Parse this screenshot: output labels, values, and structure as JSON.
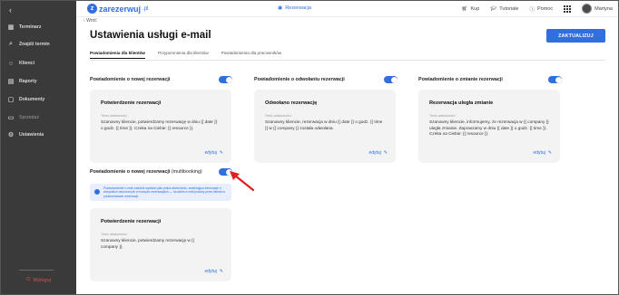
{
  "sidebar": {
    "items": [
      {
        "label": "Terminarz",
        "icon": "calendar-icon"
      },
      {
        "label": "Znajdź termin",
        "icon": "search-icon"
      },
      {
        "label": "Klienci",
        "icon": "users-icon"
      },
      {
        "label": "Raporty",
        "icon": "chart-icon"
      },
      {
        "label": "Dokumenty",
        "icon": "document-icon"
      },
      {
        "label": "Sprzedaż",
        "icon": "cart-icon"
      },
      {
        "label": "Ustawienia",
        "icon": "gear-icon"
      }
    ],
    "logout_label": "Wyloguj"
  },
  "topbar": {
    "logo_text": "zarezerwuj",
    "logo_tld": ".pl",
    "center_label": "Rezerwacja",
    "shop_label": "Kup",
    "tutorials_label": "Tutoriale",
    "help_label": "Pomoc",
    "user_name": "Martyna"
  },
  "main": {
    "back_label": "Wróć",
    "title": "Ustawienia usługi e-mail",
    "update_button": "ZAKTUALIZUJ",
    "tabs": [
      {
        "label": "Powiadomienia dla klientów",
        "active": true
      },
      {
        "label": "Przypomnienia dla klientów",
        "active": false
      },
      {
        "label": "Powiadomienia dla pracowników",
        "active": false
      }
    ],
    "sections": [
      {
        "title": "Powiadomienie o nowej rezerwacji",
        "enabled": true,
        "card": {
          "title": "Potwierdzenie rezerwacji",
          "label": "Treść wiadomości",
          "text": "Szanowny kliencie, potwierdzamy rezerwację w dniu {{ date }} o godz. {{ time }}. Czeka na Ciebie: {{ resource }}.",
          "edit": "edytuj"
        }
      },
      {
        "title": "Powiadomienie o odwołaniu rezerwacji",
        "enabled": true,
        "card": {
          "title": "Odwołano rezerwację",
          "label": "Treść wiadomości",
          "text": "Szanowny kliencie, rezerwacja w dniu {{ date }} o godz. {{ time }} w {{ company }} została odwołana.",
          "edit": "edytuj"
        }
      },
      {
        "title": "Powiadomienie o zmianie rezerwacji",
        "enabled": true,
        "card": {
          "title": "Rezerwacja uległa zmianie",
          "label": "Treść wiadomości",
          "text": "Szanowny kliencie, informujemy, że rezerwacja w {{ company }} uległa zmianie. Zapraszamy w dniu {{ date }} o godz. {{ time }}. Czeka na Ciebie: {{ resource }}.",
          "edit": "edytuj"
        }
      }
    ],
    "multibooking": {
      "title_main": "Powiadomienie o nowej rezerwacji",
      "title_suffix": "(multibooking)",
      "enabled": true,
      "info": "Powiadomienie e-mail zostanie wysłane jako jedna wiadomość, zawierająca informacje o wszystkich utworzonych w koszyku rezerwacjach — na adres e-mail podany przez klienta w podsumowaniu rezerwacji.",
      "card": {
        "title": "Potwierdzenie rezerwacji",
        "label": "Treść wiadomości",
        "text": "Szanowny kliencie, potwierdzamy rezerwację w {{ company }}.",
        "edit": "edytuj"
      }
    }
  },
  "colors": {
    "accent": "#2f6fe0",
    "sidebar_bg": "#3a3a3a",
    "card_bg": "#f3f3f3",
    "logout": "#d9534f",
    "annotation_arrow": "#e02020"
  }
}
